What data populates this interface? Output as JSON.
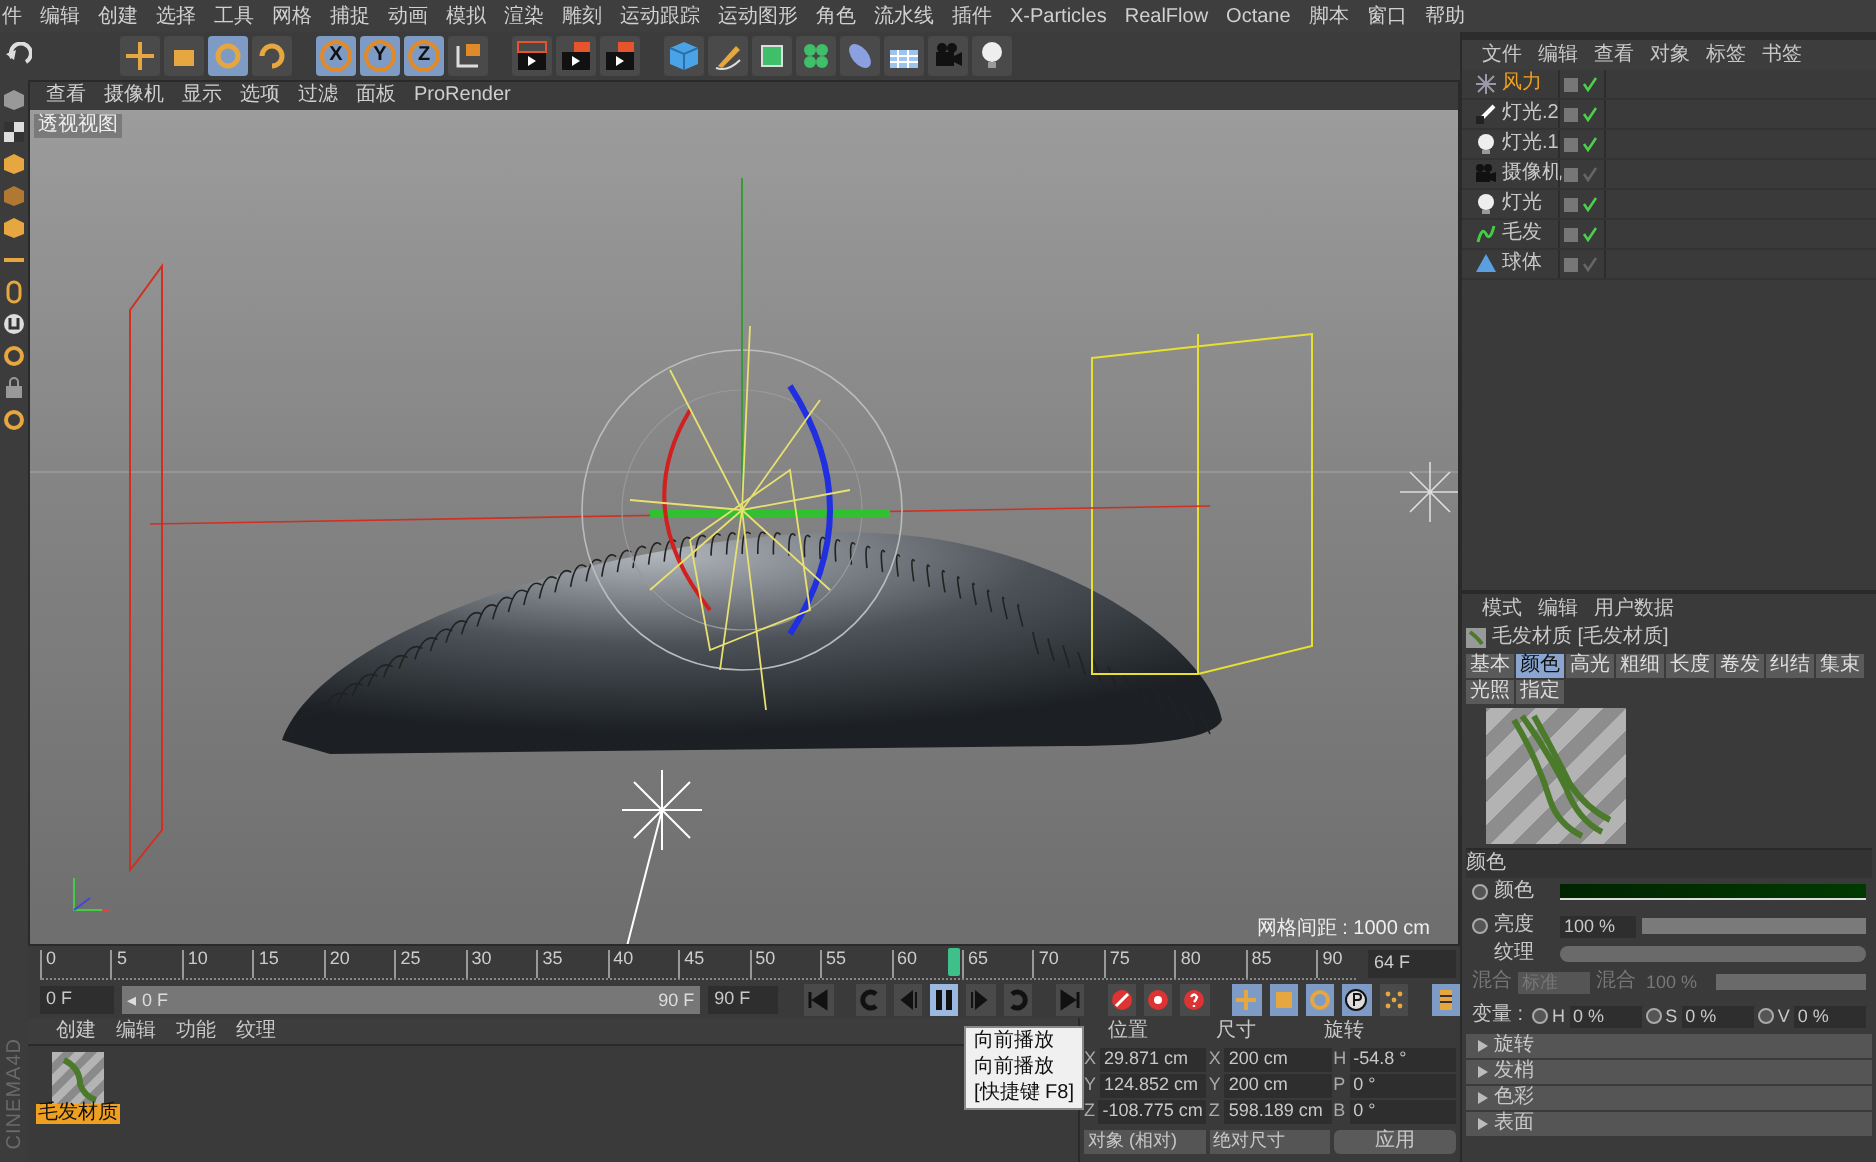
{
  "menu_bar": [
    "件",
    "编辑",
    "创建",
    "选择",
    "工具",
    "网格",
    "捕捉",
    "动画",
    "模拟",
    "渲染",
    "雕刻",
    "运动跟踪",
    "运动图形",
    "角色",
    "流水线",
    "插件",
    "X-Particles",
    "RealFlow",
    "Octane",
    "脚本",
    "窗口",
    "帮助"
  ],
  "axis_buttons": [
    {
      "label": "X",
      "selected": true
    },
    {
      "label": "Y",
      "selected": true
    },
    {
      "label": "Z",
      "selected": true
    }
  ],
  "viewport": {
    "menu": [
      "查看",
      "摄像机",
      "显示",
      "选项",
      "过滤",
      "面板",
      "ProRender"
    ],
    "view_label": "透视视图",
    "grid_info": "网格间距 : 1000 cm"
  },
  "timeline": {
    "ticks": [
      "0",
      "5",
      "10",
      "15",
      "20",
      "25",
      "30",
      "35",
      "40",
      "45",
      "50",
      "55",
      "60",
      "65",
      "70",
      "75",
      "80",
      "85",
      "90"
    ],
    "playhead": {
      "level": 0.711
    },
    "current_frame": "64 F"
  },
  "playback": {
    "start_field": "0 F",
    "range_start": "◂ 0 F",
    "range_end": "90 F",
    "end_field": "90 F",
    "range": {
      "level": 1
    },
    "play": {
      "selected": true
    }
  },
  "tooltip": [
    "向前播放",
    "向前播放",
    "[快捷键 F8]"
  ],
  "brand_text": "CINEMA4D",
  "material_manager": {
    "menu": [
      "创建",
      "编辑",
      "功能",
      "纹理"
    ],
    "materials": [
      {
        "name": "毛发材质",
        "selected": true
      }
    ]
  },
  "coordinates": {
    "headers": [
      "位置",
      "尺寸",
      "旋转"
    ],
    "rows": [
      {
        "pos_axis": "X",
        "pos": "29.871 cm",
        "size_axis": "X",
        "size": "200 cm",
        "rot_axis": "H",
        "rot": "-54.8 °"
      },
      {
        "pos_axis": "Y",
        "pos": "124.852 cm",
        "size_axis": "Y",
        "size": "200 cm",
        "rot_axis": "P",
        "rot": "0 °"
      },
      {
        "pos_axis": "Z",
        "pos": "-108.775 cm",
        "size_axis": "Z",
        "size": "598.189 cm",
        "rot_axis": "B",
        "rot": "0 °"
      }
    ],
    "mode_dropdown": "对象 (相对)",
    "size_dropdown": "绝对尺寸",
    "apply_button": "应用"
  },
  "object_manager": {
    "menu": [
      "文件",
      "编辑",
      "查看",
      "对象",
      "标签",
      "书签"
    ],
    "objects": [
      {
        "name": "风力",
        "kind": "wind",
        "selected": true,
        "enabled": true
      },
      {
        "name": "灯光.2",
        "kind": "spot",
        "selected": false,
        "enabled": true
      },
      {
        "name": "灯光.1",
        "kind": "light",
        "selected": false,
        "enabled": true
      },
      {
        "name": "摄像机",
        "kind": "camera",
        "selected": false,
        "enabled": false
      },
      {
        "name": "灯光",
        "kind": "light",
        "selected": false,
        "enabled": true
      },
      {
        "name": "毛发",
        "kind": "hair",
        "selected": false,
        "enabled": true
      },
      {
        "name": "球体",
        "kind": "sphere",
        "selected": false,
        "enabled": false
      }
    ]
  },
  "attributes": {
    "menu": [
      "模式",
      "编辑",
      "用户数据"
    ],
    "title": "毛发材质 [毛发材质]",
    "tabs": [
      {
        "label": "基本",
        "selected": false
      },
      {
        "label": "颜色",
        "selected": true
      },
      {
        "label": "高光",
        "selected": false
      },
      {
        "label": "粗细",
        "selected": false
      },
      {
        "label": "长度",
        "selected": false
      },
      {
        "label": "卷发",
        "selected": false
      },
      {
        "label": "纠结",
        "selected": false
      },
      {
        "label": "集束",
        "selected": false
      },
      {
        "label": "光照",
        "selected": false
      },
      {
        "label": "指定",
        "selected": false
      }
    ],
    "section": "颜色",
    "color_label": "颜色",
    "color_keyframe": false,
    "brightness": {
      "label": "亮度",
      "value": "100 %",
      "keyframe": false,
      "level": 1
    },
    "texture_label": "纹理",
    "mix": [
      {
        "label": "混合",
        "value": "标准",
        "disabled": true
      },
      {
        "label": "混合",
        "value": "100 %",
        "disabled": true,
        "level": 1
      }
    ],
    "variation": {
      "label": "变量 :",
      "fields": [
        {
          "axis": "H",
          "value": "0 %",
          "keyframe": false
        },
        {
          "axis": "S",
          "value": "0 %",
          "keyframe": false
        },
        {
          "axis": "V",
          "value": "0 %",
          "keyframe": false
        }
      ]
    },
    "groups": [
      "旋转",
      "发梢",
      "色彩",
      "表面"
    ]
  }
}
